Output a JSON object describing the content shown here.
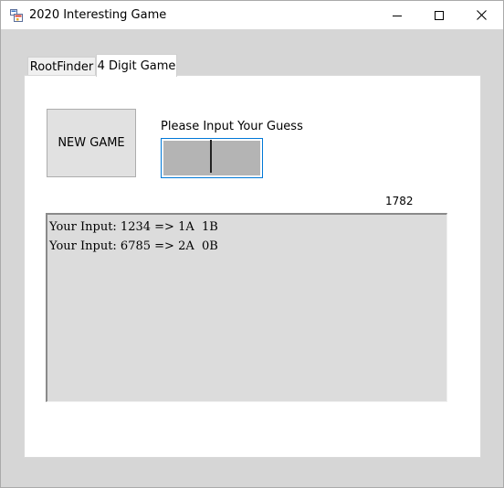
{
  "window": {
    "title": "2020 Interesting Game"
  },
  "tabs": [
    {
      "label": "RootFinder",
      "selected": false
    },
    {
      "label": "4 Digit Game",
      "selected": true
    }
  ],
  "game": {
    "new_game_label": "NEW GAME",
    "prompt": "Please Input Your Guess",
    "guess_value": "",
    "answer": "1782",
    "history": [
      "Your Input: 1234 => 1A  1B",
      "Your Input: 6785 => 2A  0B"
    ]
  },
  "colors": {
    "focus_border": "#0078d7",
    "input_fill": "#b4b4b4",
    "log_background": "#dcdcdc"
  }
}
